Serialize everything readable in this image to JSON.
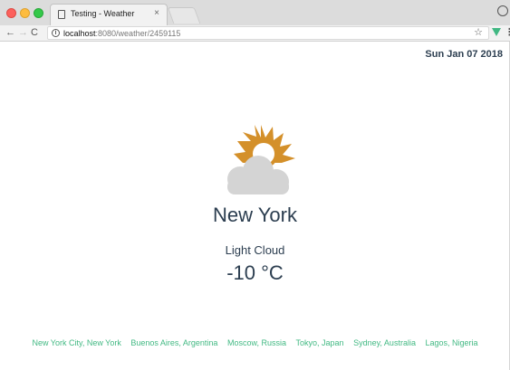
{
  "browser": {
    "tab_title": "Testing - Weather",
    "tab_close": "×",
    "nav": {
      "back": "←",
      "forward": "→",
      "reload": "C"
    },
    "address": {
      "info": "i",
      "host": "localhost",
      "path": ":8080/weather/2459115"
    },
    "bookmark_star": "☆",
    "menu": "⋮"
  },
  "page": {
    "date": "Sun Jan 07 2018",
    "city": "New York",
    "condition": "Light Cloud",
    "temperature": "-10 °C",
    "weather_icon": "light-cloud-icon",
    "cities": [
      "New York City, New York",
      "Buenos Aires, Argentina",
      "Moscow, Russia",
      "Tokyo, Japan",
      "Sydney, Australia",
      "Lagos, Nigeria"
    ]
  },
  "colors": {
    "accent_green": "#42b983",
    "text_dark": "#2c3e50",
    "sun": "#d4902a",
    "cloud": "#d4d4d4"
  }
}
